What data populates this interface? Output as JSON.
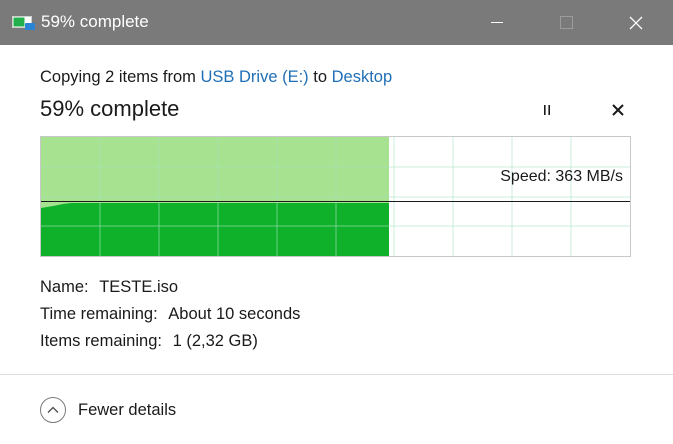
{
  "window": {
    "title": "59% complete",
    "icons": {
      "app": "copy-progress-icon",
      "minimize": "minimize-icon",
      "maximize": "maximize-icon",
      "close": "close-icon"
    }
  },
  "dialog": {
    "copy_prefix": "Copying 2 items from",
    "source": "USB Drive (E:)",
    "to_word": "to",
    "destination": "Desktop",
    "progress_title": "59% complete",
    "progress_fraction": 0.59,
    "speed_text": "Speed: 363 MB/s",
    "speed_level_fraction": 0.46,
    "name_label": "Name:",
    "name_value": "TESTE.iso",
    "time_label": "Time remaining:",
    "time_value": "About 10 seconds",
    "items_label": "Items remaining:",
    "items_value": "1 (2,32 GB)",
    "details_label": "Fewer details",
    "colors": {
      "titlebar": "#7a7a7a",
      "progress_light": "#a6e28f",
      "progress_dark": "#0fb02a",
      "grid": "#a8e4c2",
      "link": "#1f6fb7"
    }
  }
}
